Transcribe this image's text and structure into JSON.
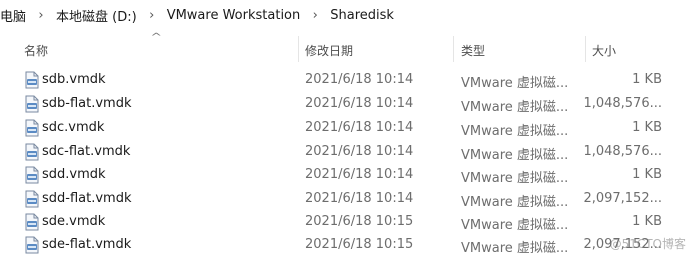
{
  "breadcrumb": {
    "items": [
      "电脑",
      "本地磁盘 (D:)",
      "VMware Workstation",
      "Sharedisk"
    ],
    "separator_icon": "chevron-right-icon"
  },
  "columns": {
    "name": "名称",
    "date": "修改日期",
    "type": "类型",
    "size": "大小"
  },
  "files": [
    {
      "name": "sdb.vmdk",
      "date": "2021/6/18 10:14",
      "type": "VMware 虚拟磁...",
      "size": "1 KB",
      "icon": "vmdk-file-icon"
    },
    {
      "name": "sdb-flat.vmdk",
      "date": "2021/6/18 10:14",
      "type": "VMware 虚拟磁...",
      "size": "1,048,576...",
      "icon": "vmdk-file-icon"
    },
    {
      "name": "sdc.vmdk",
      "date": "2021/6/18 10:14",
      "type": "VMware 虚拟磁...",
      "size": "1 KB",
      "icon": "vmdk-file-icon"
    },
    {
      "name": "sdc-flat.vmdk",
      "date": "2021/6/18 10:14",
      "type": "VMware 虚拟磁...",
      "size": "1,048,576...",
      "icon": "vmdk-file-icon"
    },
    {
      "name": "sdd.vmdk",
      "date": "2021/6/18 10:14",
      "type": "VMware 虚拟磁...",
      "size": "1 KB",
      "icon": "vmdk-file-icon"
    },
    {
      "name": "sdd-flat.vmdk",
      "date": "2021/6/18 10:14",
      "type": "VMware 虚拟磁...",
      "size": "2,097,152...",
      "icon": "vmdk-file-icon"
    },
    {
      "name": "sde.vmdk",
      "date": "2021/6/18 10:15",
      "type": "VMware 虚拟磁...",
      "size": "1 KB",
      "icon": "vmdk-file-icon"
    },
    {
      "name": "sde-flat.vmdk",
      "date": "2021/6/18 10:15",
      "type": "VMware 虚拟磁...",
      "size": "2,097,152...",
      "icon": "vmdk-file-icon"
    }
  ],
  "watermark": "@51CTO博客"
}
